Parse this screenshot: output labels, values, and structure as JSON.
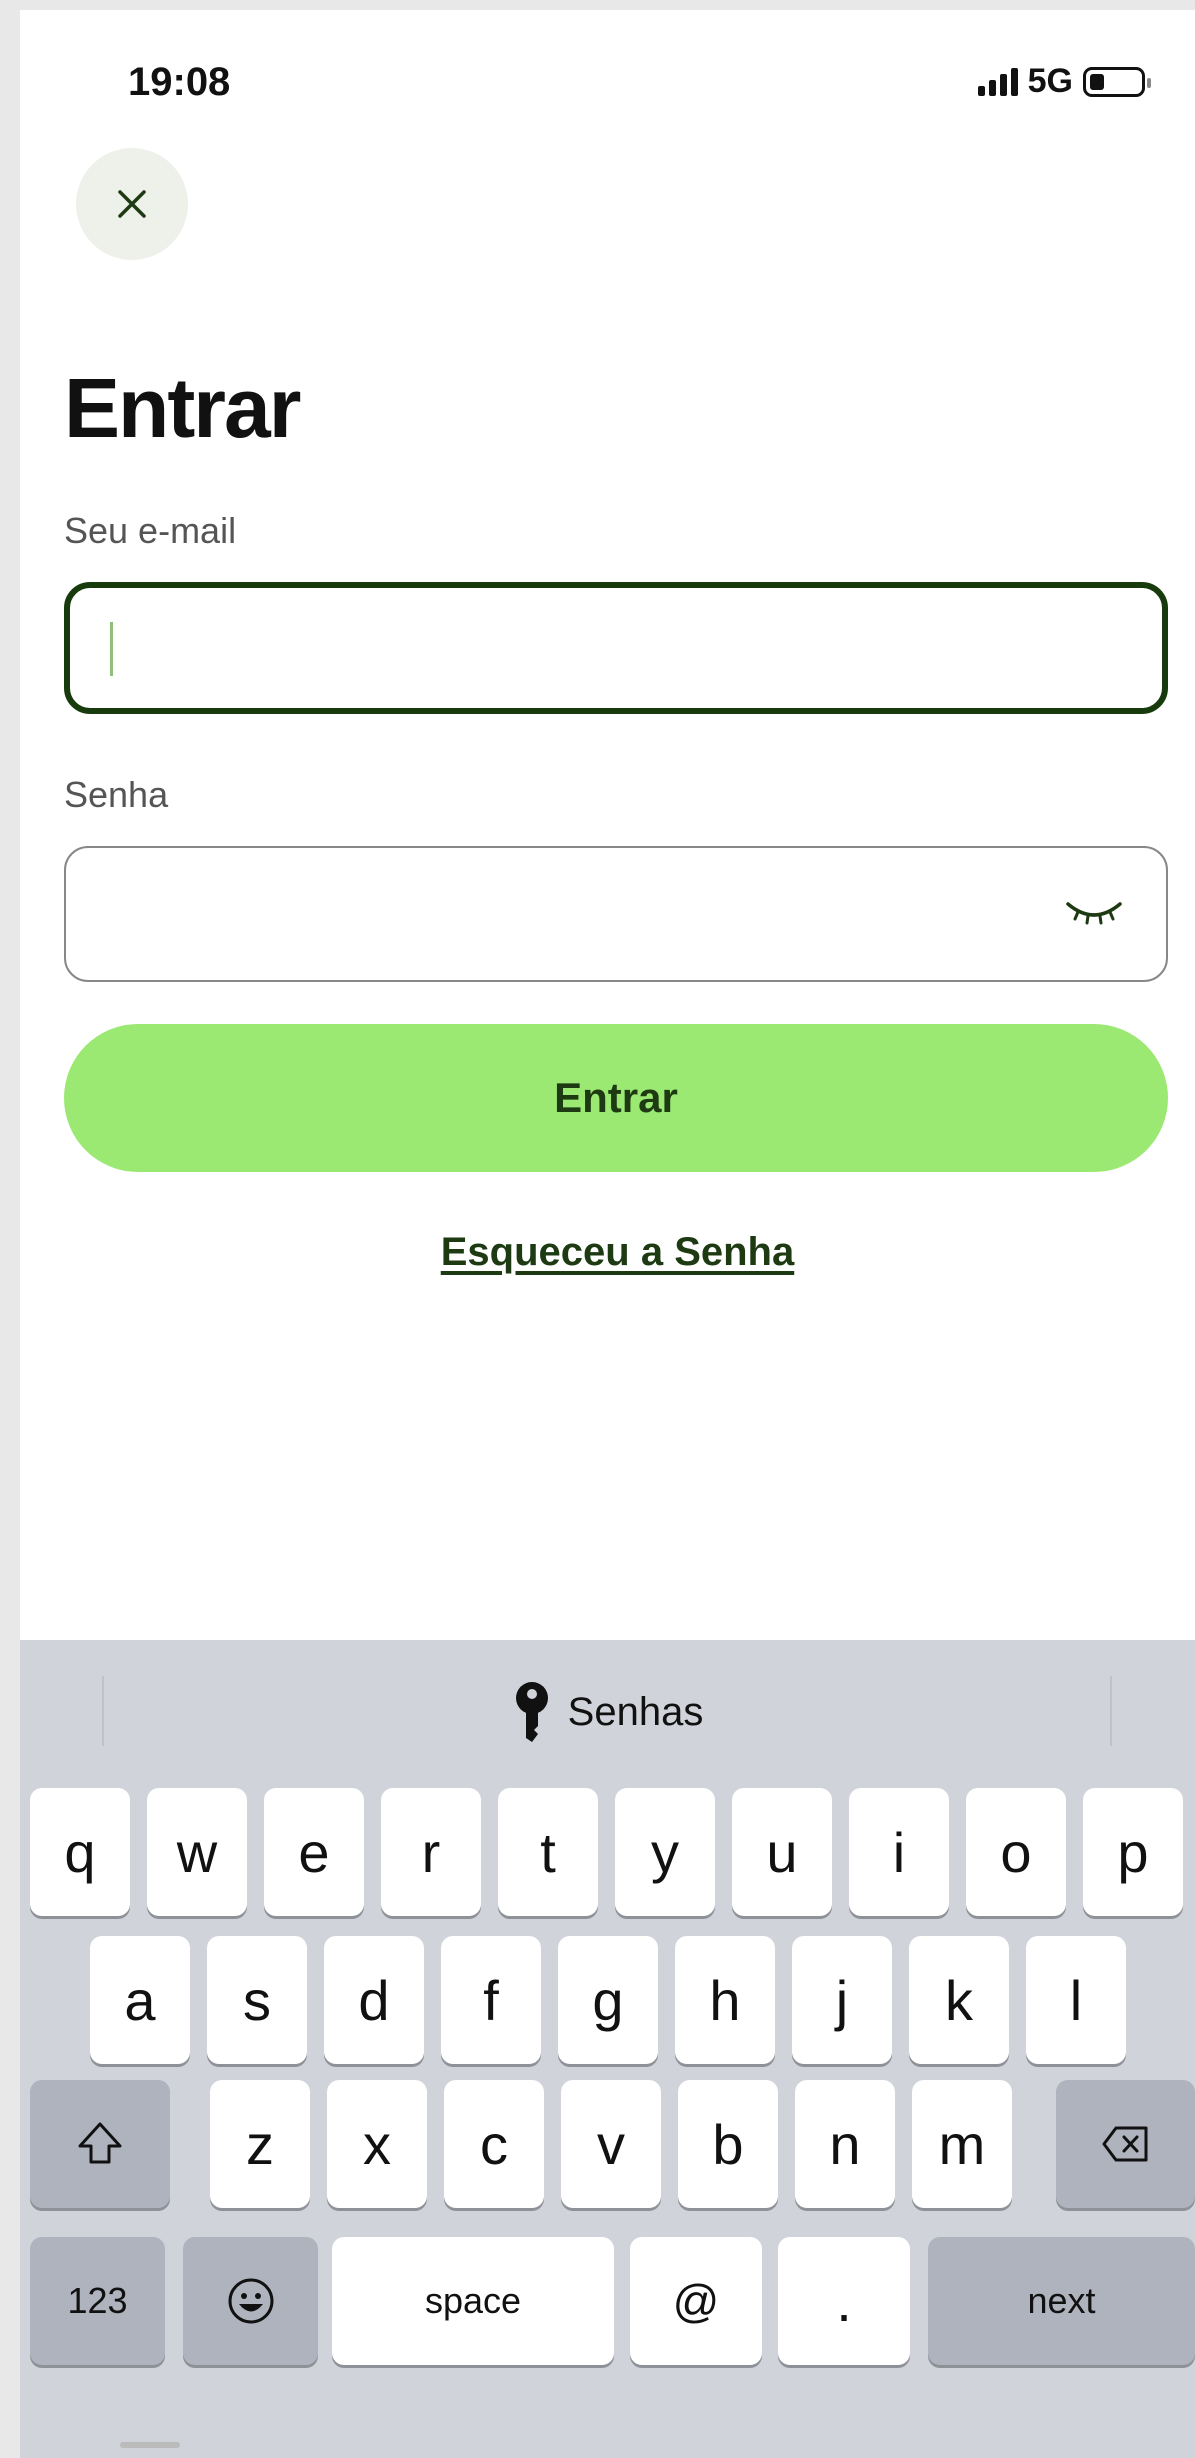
{
  "status_bar": {
    "time": "19:08",
    "network": "5G",
    "icons": [
      "signal-icon",
      "battery-icon"
    ]
  },
  "close_button": {
    "icon": "close-icon"
  },
  "title": "Entrar",
  "email": {
    "label": "Seu e-mail",
    "value": "",
    "placeholder": ""
  },
  "password": {
    "label": "Senha",
    "value": "",
    "placeholder": "",
    "toggle_icon": "eye-closed-icon"
  },
  "submit_label": "Entrar",
  "forgot_label": "Esqueceu a Senha",
  "colors": {
    "accent": "#9be873",
    "accent_text": "#1d3a12",
    "focus_border": "#183b0d",
    "keyboard_bg": "#d0d3da"
  },
  "keyboard": {
    "suggestion": "Senhas",
    "suggestion_icon": "key-icon",
    "row1": [
      "q",
      "w",
      "e",
      "r",
      "t",
      "y",
      "u",
      "i",
      "o",
      "p"
    ],
    "row2": [
      "a",
      "s",
      "d",
      "f",
      "g",
      "h",
      "j",
      "k",
      "l"
    ],
    "row3": [
      "z",
      "x",
      "c",
      "v",
      "b",
      "n",
      "m"
    ],
    "shift_icon": "shift-icon",
    "delete_icon": "backspace-icon",
    "numbers_label": "123",
    "emoji_icon": "emoji-icon",
    "space_label": "space",
    "at_label": "@",
    "dot_label": ".",
    "next_label": "next"
  }
}
